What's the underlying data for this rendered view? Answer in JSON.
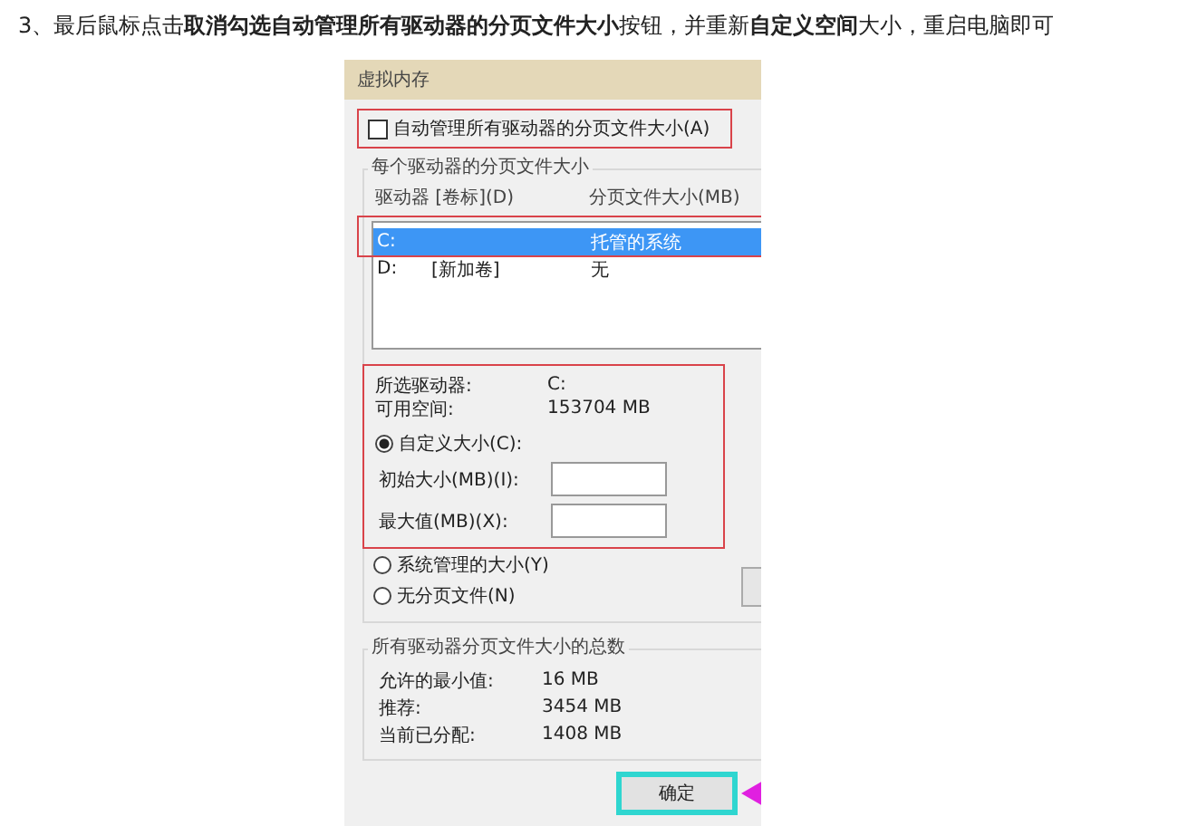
{
  "instruction": "3、最后鼠标点击**取消勾选自动管理所有驱动器的分页文件大小**按钮，并重新**自定义空间**大小，重启电脑即可",
  "dialog": {
    "title": "虚拟内存",
    "auto_manage": {
      "label": "自动管理所有驱动器的分页文件大小(A)",
      "checked": false
    },
    "per_drive": {
      "legend": "每个驱动器的分页文件大小",
      "columns": [
        "驱动器 [卷标](D)",
        "分页文件大小(MB)"
      ],
      "drives": [
        {
          "drive": "C:",
          "size": "托管的系统",
          "selected": true
        },
        {
          "drive": "D:",
          "label": "[新加卷]",
          "size": "无",
          "selected": false
        }
      ],
      "info": [
        {
          "label": "所选驱动器:",
          "value": "C:"
        },
        {
          "label": "可用空间:",
          "value": "153704 MB"
        }
      ],
      "options": [
        {
          "kind": "custom",
          "label": "自定义大小(C):",
          "selected": true,
          "fields": [
            {
              "label": "初始大小(MB)(I):"
            },
            {
              "label": "最大值(MB)(X):"
            }
          ]
        },
        {
          "kind": "plain",
          "label": "系统管理的大小(Y)",
          "selected": false
        },
        {
          "kind": "plain",
          "label": "无分页文件(N)",
          "selected": false
        }
      ]
    },
    "totals": {
      "legend": "所有驱动器分页文件大小的总数",
      "rows": [
        {
          "label": "允许的最小值:",
          "value": "16 MB"
        },
        {
          "label": "推荐:",
          "value": "3454 MB"
        },
        {
          "label": "当前已分配:",
          "value": "1408 MB"
        }
      ]
    },
    "ok_button": "确定"
  }
}
